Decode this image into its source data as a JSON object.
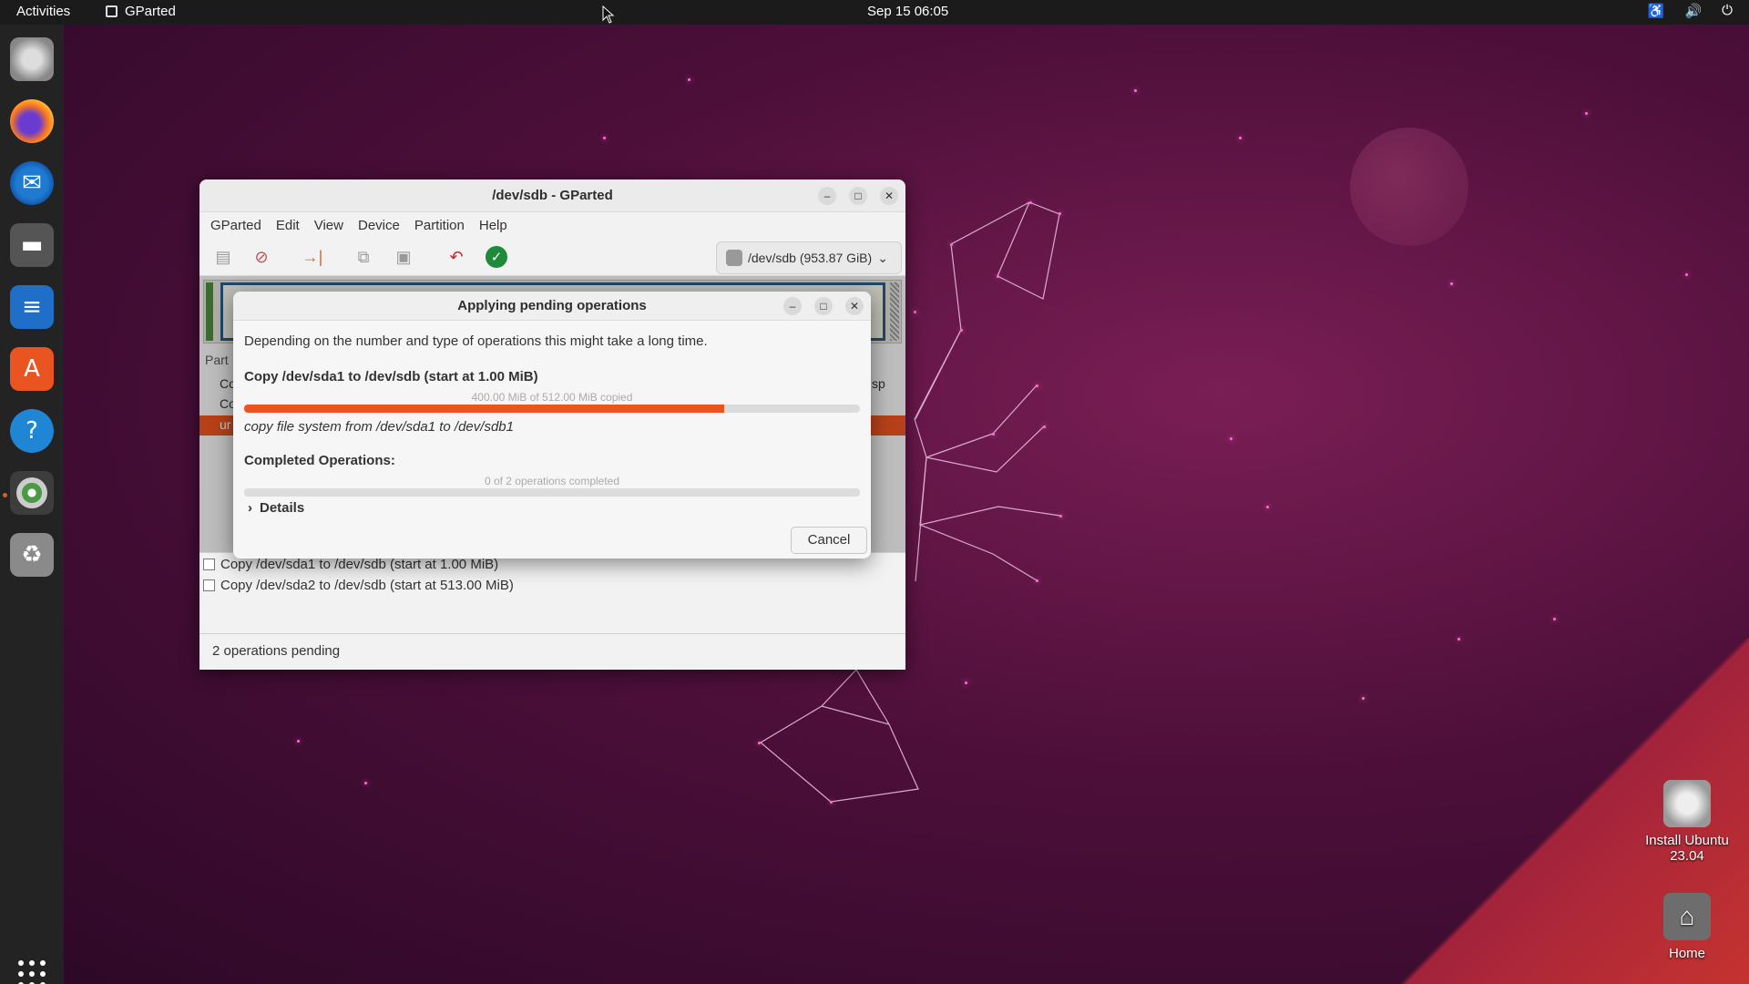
{
  "topbar": {
    "activities": "Activities",
    "app_name": "GParted",
    "clock": "Sep 15  06:05",
    "tray_icons": [
      "accessibility-icon",
      "volume-icon",
      "power-icon"
    ]
  },
  "dock": {
    "items": [
      "installer",
      "firefox",
      "thunderbird",
      "files",
      "writer",
      "app-center",
      "help",
      "gparted",
      "trash"
    ],
    "show_apps": "grid-icon"
  },
  "desktop": {
    "install": {
      "line1": "Install Ubuntu",
      "line2": "23.04"
    },
    "home": {
      "label": "Home"
    }
  },
  "gparted": {
    "title": "/dev/sdb - GParted",
    "menu": [
      "GParted",
      "Edit",
      "View",
      "Device",
      "Partition",
      "Help"
    ],
    "device": "/dev/sdb (953.87 GiB)",
    "partition_label": "Part",
    "rows": [
      "Co",
      "Co",
      "ur"
    ],
    "right_frag": "sp",
    "operations": [
      "Copy /dev/sda1 to /dev/sdb (start at 1.00 MiB)",
      "Copy /dev/sda2 to /dev/sdb (start at 513.00 MiB)"
    ],
    "status": "2 operations pending"
  },
  "dialog": {
    "title": "Applying pending operations",
    "intro": "Depending on the number and type of operations this might take a long time.",
    "current_op": "Copy /dev/sda1 to /dev/sdb (start at 1.00 MiB)",
    "progress_text": "400.00 MiB of 512.00 MiB copied",
    "progress_fraction": 0.78,
    "sub_op": "copy file system from /dev/sda1 to /dev/sdb1",
    "completed_heading": "Completed Operations:",
    "completed_text": "0 of 2 operations completed",
    "completed_fraction": 0,
    "details": "Details",
    "cancel": "Cancel"
  },
  "colors": {
    "accent": "#e95420",
    "topbar": "#1b1b1b",
    "dock": "#232323"
  }
}
